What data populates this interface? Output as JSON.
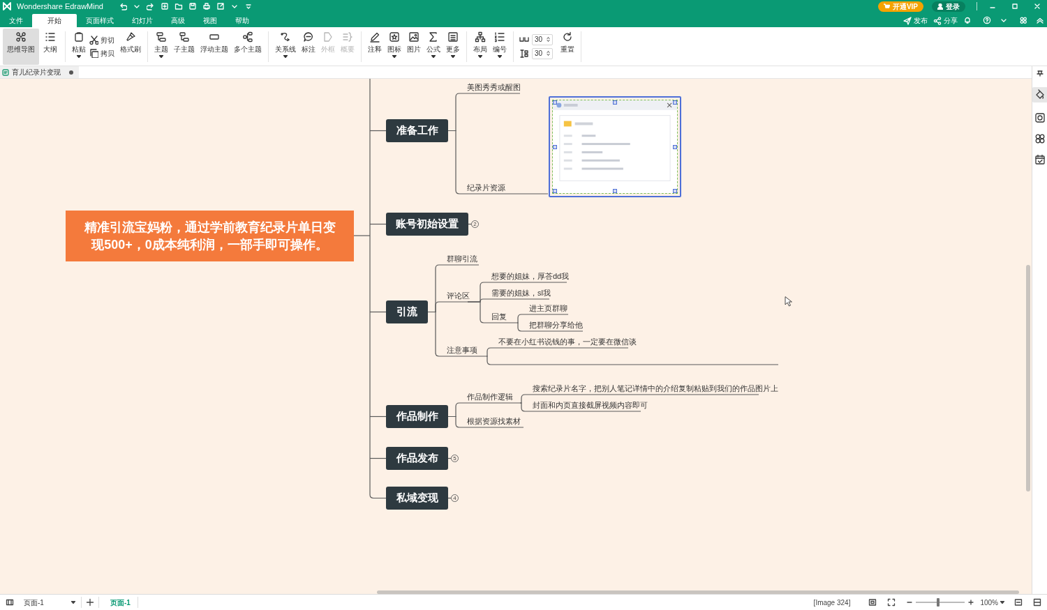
{
  "app": {
    "title": "Wondershare EdrawMind",
    "vip_button": "开通VIP",
    "login_button": "登录"
  },
  "menu_tabs": [
    {
      "label": "文件",
      "selected": false
    },
    {
      "label": "开始",
      "selected": true
    },
    {
      "label": "页面样式",
      "selected": false
    },
    {
      "label": "幻灯片",
      "selected": false
    },
    {
      "label": "高级",
      "selected": false
    },
    {
      "label": "视图",
      "selected": false
    },
    {
      "label": "帮助",
      "selected": false
    }
  ],
  "menu_actions": [
    "发布",
    "分享"
  ],
  "toolbar": {
    "view_modes": [
      {
        "label": "思维导图",
        "selected": true
      },
      {
        "label": "大纲",
        "selected": false
      }
    ],
    "groups": [
      [
        {
          "label": "粘贴",
          "kind": "big",
          "dropdown": true,
          "disabled": false
        },
        {
          "label": "剪切",
          "kind": "small"
        },
        {
          "label": "拷贝",
          "kind": "small"
        },
        {
          "label": "格式刷",
          "kind": "big",
          "dropdown": false,
          "disabled": false
        }
      ],
      [
        {
          "label": "主题",
          "kind": "big",
          "dropdown": true,
          "disabled": false
        },
        {
          "label": "子主题",
          "kind": "big",
          "dropdown": false,
          "disabled": false
        },
        {
          "label": "浮动主题",
          "kind": "big",
          "dropdown": false,
          "disabled": false
        },
        {
          "label": "多个主题",
          "kind": "big",
          "dropdown": false,
          "disabled": false
        }
      ],
      [
        {
          "label": "关系线",
          "kind": "big",
          "dropdown": true,
          "disabled": false
        },
        {
          "label": "标注",
          "kind": "big",
          "dropdown": false,
          "disabled": false
        },
        {
          "label": "外框",
          "kind": "big",
          "dropdown": false,
          "disabled": true
        },
        {
          "label": "概要",
          "kind": "big",
          "dropdown": false,
          "disabled": true
        }
      ],
      [
        {
          "label": "注释",
          "kind": "big",
          "dropdown": false,
          "disabled": false
        },
        {
          "label": "图标",
          "kind": "big",
          "dropdown": true,
          "disabled": false
        },
        {
          "label": "图片",
          "kind": "big",
          "dropdown": false,
          "disabled": false
        },
        {
          "label": "公式",
          "kind": "big",
          "dropdown": true,
          "disabled": false
        },
        {
          "label": "更多",
          "kind": "big",
          "dropdown": true,
          "disabled": false
        }
      ],
      [
        {
          "label": "布局",
          "kind": "big",
          "dropdown": true,
          "disabled": false
        },
        {
          "label": "编号",
          "kind": "big",
          "dropdown": true,
          "disabled": false
        }
      ]
    ],
    "spacing": [
      "30",
      "30"
    ],
    "reset": "重置"
  },
  "document_tab": {
    "title": "育儿纪录片变现",
    "modified": true
  },
  "mind_map": {
    "central_topic": "精准引流宝妈粉，通过学前教育纪录片单日变现500+，0成本纯利润，一部手即可操作。",
    "topics": [
      {
        "text": "准备工作",
        "children": [
          {
            "text": "美图秀秀或醒图"
          },
          {
            "text": "纪录片资源",
            "image": {
              "kind": "picture",
              "selected": true
            }
          }
        ]
      },
      {
        "text": "账号初始设置",
        "collapsed_count": "2"
      },
      {
        "text": "引流",
        "children": [
          {
            "text": "群聊引流"
          },
          {
            "text": "评论区",
            "children": [
              {
                "text": "想要的姐妹，厚荅dd我"
              },
              {
                "text": "需要的姐妹，sl我"
              },
              {
                "text": "回复",
                "children": [
                  {
                    "text": "进主页群聊"
                  },
                  {
                    "text": "把群聊分享给他"
                  }
                ]
              }
            ]
          },
          {
            "text": "注意事项",
            "children": [
              {
                "text": "不要在小红书说钱的事，一定要在微信谈"
              },
              {
                "kind": "blank"
              }
            ]
          }
        ]
      },
      {
        "text": "作品制作",
        "children": [
          {
            "text": "作品制作逻辑",
            "children": [
              {
                "text": "搜索纪录片名字，把别人笔记详情中的介绍复制粘贴到我们的作品图片上"
              },
              {
                "text": "封面和内页直接截屏视频内容即可"
              }
            ]
          },
          {
            "text": "根据资源找素材"
          }
        ]
      },
      {
        "text": "作品发布",
        "collapsed_count": "5"
      },
      {
        "text": "私域变现",
        "collapsed_count": "4"
      }
    ]
  },
  "status_bar": {
    "page_select": "页面-1",
    "pages": [
      {
        "label": "页面-1",
        "selected": true
      }
    ],
    "selection_info": "[Image 324]",
    "zoom": {
      "level": 0.45,
      "reading": "100%"
    }
  }
}
